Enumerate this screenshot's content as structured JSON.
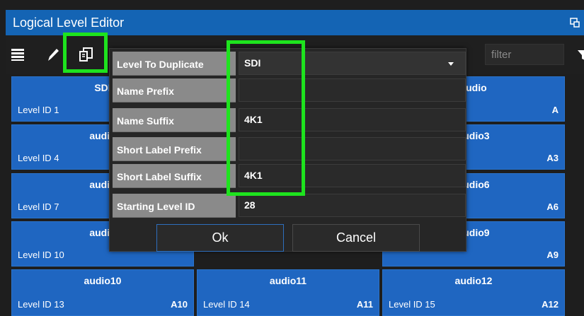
{
  "window": {
    "title": "Logical Level Editor",
    "icon": "window-restore-icon"
  },
  "toolbar": {
    "icons": [
      "list-icon",
      "pencil-icon",
      "duplicate-icon"
    ],
    "filter_placeholder": "filter",
    "filter_icon": "funnel-icon"
  },
  "tiles": [
    {
      "name": "SDI",
      "level_id": "Level ID 1",
      "label": ""
    },
    {
      "name": "audio",
      "level_id": "",
      "label": "A"
    },
    {
      "name": "audio",
      "level_id": "Level ID 4",
      "label": ""
    },
    {
      "name": "audio3",
      "level_id": "",
      "label": "A3"
    },
    {
      "name": "audio",
      "level_id": "Level ID 7",
      "label": ""
    },
    {
      "name": "audio6",
      "level_id": "",
      "label": "A6"
    },
    {
      "name": "audio",
      "level_id": "Level ID 10",
      "label": ""
    },
    {
      "name": "audio9",
      "level_id": "",
      "label": "A9"
    },
    {
      "name": "audio10",
      "level_id": "Level ID 13",
      "label": "A10"
    },
    {
      "name": "audio11",
      "level_id": "Level ID 14",
      "label": "A11"
    },
    {
      "name": "audio12",
      "level_id": "Level ID 15",
      "label": "A12"
    }
  ],
  "dialog": {
    "fields": [
      {
        "label": "Level To Duplicate",
        "value": "SDI"
      },
      {
        "label": "Name Prefix",
        "value": ""
      },
      {
        "label": "Name Suffix",
        "value": "4K1"
      },
      {
        "label": "Short Label Prefix",
        "value": ""
      },
      {
        "label": "Short Label Suffix",
        "value": "4K1"
      },
      {
        "label": "Starting Level ID",
        "value": "28"
      }
    ],
    "ok_label": "Ok",
    "cancel_label": "Cancel"
  },
  "colors": {
    "title_bar": "#1464b4",
    "tile": "#1f66c1",
    "highlight": "#1ee31e"
  }
}
